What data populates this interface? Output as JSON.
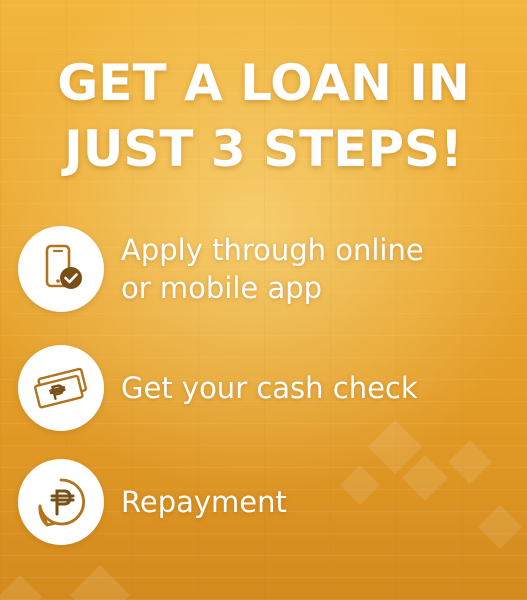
{
  "headline": {
    "line1": "GET A LOAN IN",
    "line2": "JUST 3 STEPS!"
  },
  "steps": [
    {
      "icon": "phone-check-icon",
      "line1": "Apply through online",
      "line2": "or mobile app"
    },
    {
      "icon": "peso-bill-icon",
      "line1": "Get your cash check"
    },
    {
      "icon": "peso-refresh-icon",
      "line1": "Repayment"
    }
  ],
  "colors": {
    "background": "#eba72f",
    "icon_brown": "#b0731e",
    "icon_dark": "#7a4f16",
    "text": "#ffffff",
    "circle": "#ffffff"
  }
}
